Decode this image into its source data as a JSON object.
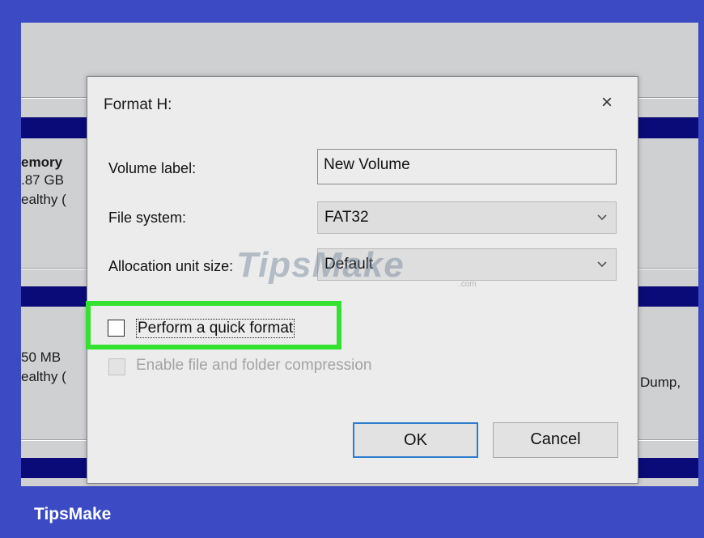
{
  "background": {
    "disk1": {
      "name": "emory",
      "size": ".87 GB",
      "status": "ealthy ("
    },
    "disk2": {
      "size": "50 MB",
      "status": "ealthy ("
    },
    "right_text": "Dump,"
  },
  "dialog": {
    "title": "Format H:",
    "close_icon": "×",
    "volume_label": {
      "label": "Volume label:",
      "value": "New Volume"
    },
    "file_system": {
      "label": "File system:",
      "selected": "FAT32"
    },
    "allocation_unit": {
      "label": "Allocation unit size:",
      "selected": "Default"
    },
    "quick_format": {
      "label": "Perform a quick format",
      "checked": false
    },
    "compression": {
      "label": "Enable file and folder compression",
      "checked": false,
      "enabled": false
    },
    "ok_label": "OK",
    "cancel_label": "Cancel"
  },
  "watermark": {
    "text": "TipsMake",
    "sub": ".com"
  },
  "brand": "TipsMake",
  "colors": {
    "frame": "#3c4bc4",
    "highlight": "#34e12e",
    "navy_band": "#0a0a78",
    "ok_border": "#2c7ccf"
  },
  "icons": {
    "close": "close-icon",
    "dropdown": "chevron-down-icon"
  }
}
